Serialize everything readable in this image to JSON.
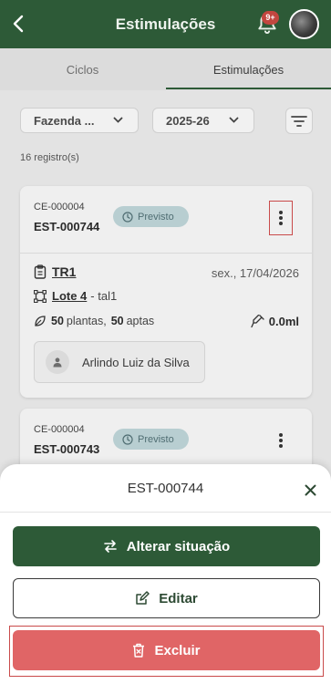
{
  "header": {
    "title": "Estimulações",
    "notification_badge": "9+",
    "back_icon": "chevron-left-icon",
    "bell_icon": "bell-icon"
  },
  "tabs": [
    {
      "label": "Ciclos",
      "active": false
    },
    {
      "label": "Estimulações",
      "active": true
    }
  ],
  "filters": {
    "fazenda": "Fazenda ...",
    "year": "2025-26"
  },
  "record_count": "16 registro(s)",
  "cards": [
    {
      "ce": "CE-000004",
      "est": "EST-000744",
      "status": "Previsto",
      "tr": "TR1",
      "date": "sex., 17/04/2026",
      "lote": "Lote 4",
      "lote_suffix": "- tal1",
      "plantas": "50",
      "plantas_label": "plantas,",
      "aptas": "50",
      "aptas_label": "aptas",
      "volume": "0.0ml",
      "person": "Arlindo Luiz da Silva"
    },
    {
      "ce": "CE-000004",
      "est": "EST-000743",
      "status": "Previsto"
    }
  ],
  "sheet": {
    "title": "EST-000744",
    "actions": {
      "alterar": "Alterar situação",
      "editar": "Editar",
      "excluir": "Excluir"
    }
  },
  "colors": {
    "primary": "#2d5a37",
    "danger": "#e06566",
    "status_badge": "#b8ced1"
  }
}
